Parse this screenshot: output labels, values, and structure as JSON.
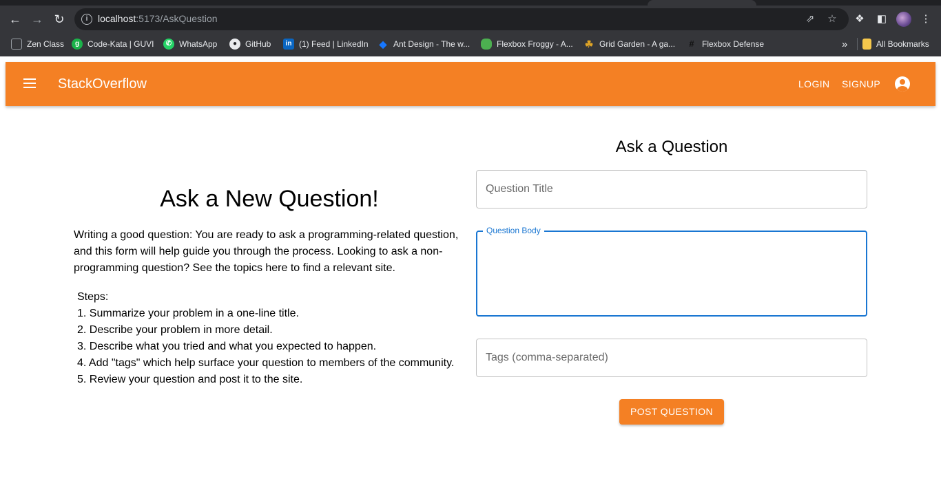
{
  "browser": {
    "url_host": "localhost",
    "url_path": ":5173/AskQuestion",
    "bookmarks": [
      {
        "label": "Zen Class",
        "icon": "page-icon"
      },
      {
        "label": "Code-Kata | GUVI",
        "icon": "guvi-icon"
      },
      {
        "label": "WhatsApp",
        "icon": "whatsapp-icon"
      },
      {
        "label": "GitHub",
        "icon": "github-icon"
      },
      {
        "label": "(1) Feed | LinkedIn",
        "icon": "linkedin-icon"
      },
      {
        "label": "Ant Design - The w...",
        "icon": "antdesign-icon"
      },
      {
        "label": "Flexbox Froggy - A...",
        "icon": "frog-icon"
      },
      {
        "label": "Grid Garden - A ga...",
        "icon": "grid-garden-icon"
      },
      {
        "label": "Flexbox Defense",
        "icon": "flexbox-defense-icon"
      }
    ],
    "overflow_label": "»",
    "all_bookmarks_label": "All Bookmarks"
  },
  "appbar": {
    "brand": "StackOverflow",
    "login_label": "LOGIN",
    "signup_label": "SIGNUP",
    "color": "#f48024"
  },
  "left": {
    "title": "Ask a New Question!",
    "intro": "Writing a good question: You are ready to ask a programming-related question, and this form will help guide you through the process. Looking to ask a non-programming question? See the topics here to find a relevant site.",
    "steps_heading": "Steps:",
    "steps": [
      "1. Summarize your problem in a one-line title.",
      "2. Describe your problem in more detail.",
      "3. Describe what you tried and what you expected to happen.",
      "4. Add \"tags\" which help surface your question to members of the community.",
      "5. Review your question and post it to the site."
    ]
  },
  "form": {
    "title": "Ask a Question",
    "question_title_placeholder": "Question Title",
    "question_body_label": "Question Body",
    "tags_placeholder": "Tags (comma-separated)",
    "submit_label": "POST QUESTION",
    "focus_color": "#1976d2"
  }
}
